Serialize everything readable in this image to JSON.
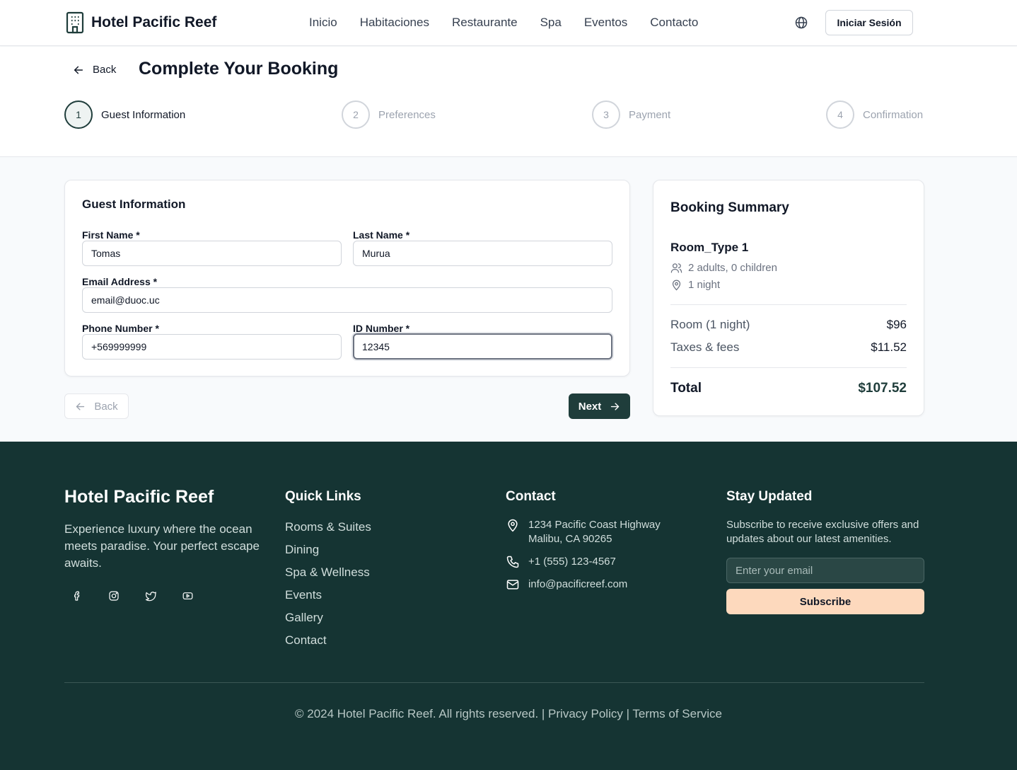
{
  "header": {
    "brand": "Hotel Pacific Reef",
    "brand_icon": "hotel-building-icon",
    "nav": [
      "Inicio",
      "Habitaciones",
      "Restaurante",
      "Spa",
      "Eventos",
      "Contacto"
    ],
    "language_icon": "globe-icon",
    "login_label": "Iniciar Sesión"
  },
  "booking": {
    "back_label": "Back",
    "title": "Complete Your Booking",
    "steps": [
      {
        "number": "1",
        "label": "Guest Information",
        "active": true
      },
      {
        "number": "2",
        "label": "Preferences",
        "active": false
      },
      {
        "number": "3",
        "label": "Payment",
        "active": false
      },
      {
        "number": "4",
        "label": "Confirmation",
        "active": false
      }
    ]
  },
  "form": {
    "title": "Guest Information",
    "first_name_label": "First Name *",
    "first_name_value": "Tomas",
    "last_name_label": "Last Name *",
    "last_name_value": "Murua",
    "email_label": "Email Address *",
    "email_value": "email@duoc.uc",
    "phone_label": "Phone Number *",
    "phone_value": "+569999999",
    "id_label": "ID Number *",
    "id_value": "12345",
    "back_label": "Back",
    "next_label": "Next"
  },
  "summary": {
    "title": "Booking Summary",
    "room_type": "Room_Type 1",
    "guests": "2 adults, 0 children",
    "nights": "1 night",
    "room_label": "Room (1 night)",
    "room_amount": "$96",
    "taxes_label": "Taxes & fees",
    "taxes_amount": "$11.52",
    "total_label": "Total",
    "total_amount": "$107.52"
  },
  "footer": {
    "brand": "Hotel Pacific Reef",
    "description": "Experience luxury where the ocean meets paradise. Your perfect escape awaits.",
    "socials": [
      "facebook-icon",
      "instagram-icon",
      "twitter-icon",
      "youtube-icon"
    ],
    "quick_links_title": "Quick Links",
    "quick_links": [
      "Rooms & Suites",
      "Dining",
      "Spa & Wellness",
      "Events",
      "Gallery",
      "Contact"
    ],
    "contact_title": "Contact",
    "address_line1": "1234 Pacific Coast Highway",
    "address_line2": "Malibu, CA 90265",
    "phone": "+1 (555) 123-4567",
    "email": "info@pacificreef.com",
    "newsletter_title": "Stay Updated",
    "newsletter_text": "Subscribe to receive exclusive offers and updates about our latest amenities.",
    "email_placeholder": "Enter your email",
    "subscribe_label": "Subscribe",
    "copyright": "© 2024 Hotel Pacific Reef. All rights reserved. | Privacy Policy | Terms of Service"
  },
  "colors": {
    "primary": "#1f3d3b",
    "footer_bg": "#153433",
    "accent": "#fdd9bd"
  }
}
